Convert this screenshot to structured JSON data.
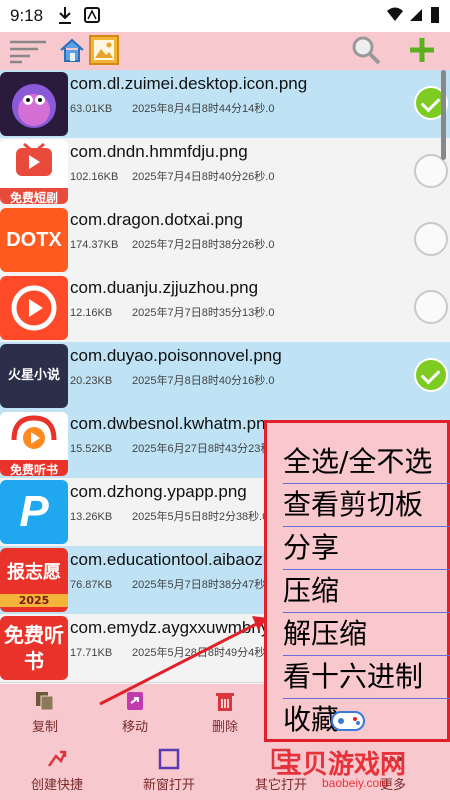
{
  "status": {
    "time": "9:18"
  },
  "toolbar": {
    "icons": [
      "menu-icon",
      "home-icon",
      "image-icon",
      "search-icon",
      "add-icon"
    ]
  },
  "files": [
    {
      "name": "com.dl.zuimei.desktop.icon.png",
      "size": "63.01KB",
      "date": "2025年8月4日8时44分14秒.0",
      "selected": true,
      "icon_text": "",
      "icon_color": "#2a1b3d"
    },
    {
      "name": "com.dndn.hmmfdju.png",
      "size": "102.16KB",
      "date": "2025年7月4日8时40分26秒.0",
      "selected": false,
      "icon_text": "免费短剧",
      "icon_color": "#e84a3c"
    },
    {
      "name": "com.dragon.dotxai.png",
      "size": "174.37KB",
      "date": "2025年7月2日8时38分26秒.0",
      "selected": false,
      "icon_text": "DOTX",
      "icon_color": "#ff5a1f"
    },
    {
      "name": "com.duanju.zjjuzhou.png",
      "size": "12.16KB",
      "date": "2025年7月7日8时35分13秒.0",
      "selected": false,
      "icon_text": "",
      "icon_color": "#ff4a2a"
    },
    {
      "name": "com.duyao.poisonnovel.png",
      "size": "20.23KB",
      "date": "2025年7月8日8时40分16秒.0",
      "selected": true,
      "icon_text": "火星小说",
      "icon_color": "#2b2f4a"
    },
    {
      "name": "com.dwbesnol.kwhatm.png",
      "size": "15.52KB",
      "date": "2025年6月27日8时43分23秒",
      "selected": true,
      "icon_text": "免费听书",
      "icon_color": "#e8322a"
    },
    {
      "name": "com.dzhong.ypapp.png",
      "size": "13.26KB",
      "date": "2025年5月5日8时2分38秒.0",
      "selected": false,
      "icon_text": "P",
      "icon_color": "#1fa8f0"
    },
    {
      "name": "com.educationtool.aibaozhiyuan.png",
      "size": "76.87KB",
      "date": "2025年5月7日8时38分47秒.0",
      "selected": true,
      "icon_text": "报志愿",
      "icon_color": "#e8322a"
    },
    {
      "name": "com.emydz.aygxxuwmbnyj.png",
      "size": "17.71KB",
      "date": "2025年5月28日8时49分4秒.0",
      "selected": false,
      "icon_text": "免费听书",
      "icon_color": "#e8322a"
    }
  ],
  "icon_sub": {
    "badge_2025": "2025"
  },
  "actions": {
    "copy": "复制",
    "move": "移动",
    "delete": "删除",
    "shortcut": "创建快捷",
    "new_window": "新窗打开",
    "open_other": "其它打开",
    "more": "更多"
  },
  "context_menu": [
    "全选/全不选",
    "查看剪切板",
    "分享",
    "压缩",
    "解压缩",
    "看十六进制",
    "收藏"
  ],
  "watermark": {
    "title": "宝贝游戏网",
    "url": "baobeiy.com"
  },
  "colors": {
    "accent": "#e0202a",
    "selected_row": "#bfe3f5",
    "toolbar": "#f7c9cf",
    "check": "#7ecb22"
  }
}
